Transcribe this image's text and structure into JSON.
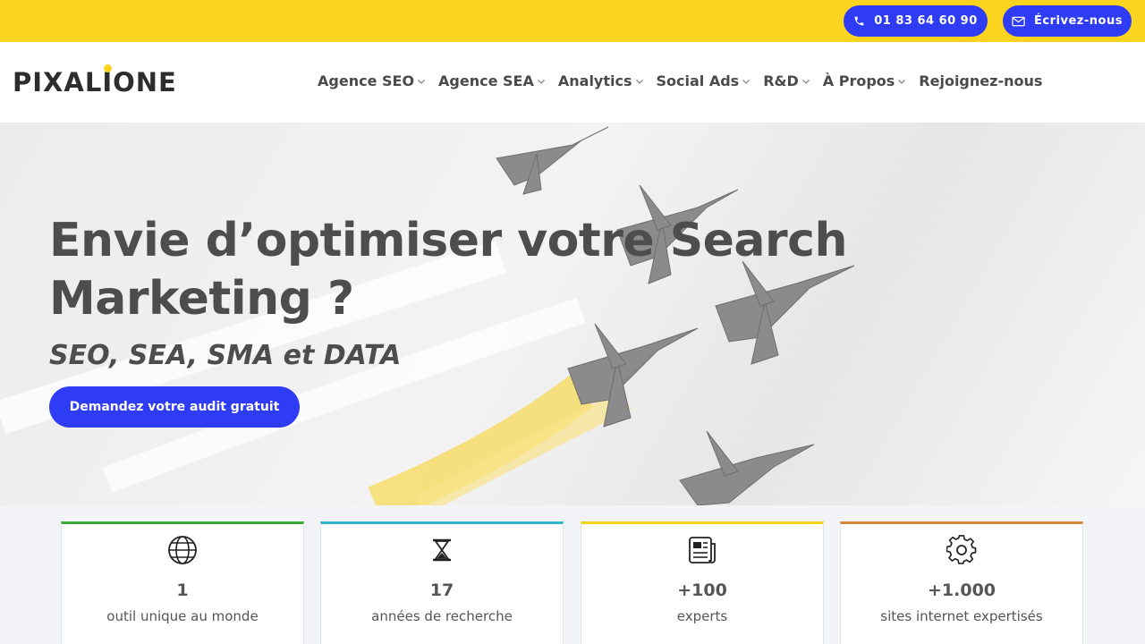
{
  "topbar": {
    "phone_label": "01 83 64 60 90",
    "mail_label": "Écrivez-nous",
    "background_color": "#fad41f",
    "button_color": "#2f3cf5"
  },
  "header": {
    "logo_before": "PIXAL",
    "logo_i": "I",
    "logo_after": "ONE",
    "nav": [
      {
        "label": "Agence SEO",
        "has_dropdown": true
      },
      {
        "label": "Agence SEA",
        "has_dropdown": true
      },
      {
        "label": "Analytics",
        "has_dropdown": true
      },
      {
        "label": "Social Ads",
        "has_dropdown": true
      },
      {
        "label": "R&D",
        "has_dropdown": true
      },
      {
        "label": "À Propos",
        "has_dropdown": true
      },
      {
        "label": "Rejoignez-nous",
        "has_dropdown": false
      }
    ]
  },
  "hero": {
    "title": "Envie d’optimiser votre Search Marketing ?",
    "subtitle": "SEO, SEA, SMA et DATA",
    "cta_label": "Demandez votre audit gratuit"
  },
  "stats": [
    {
      "icon": "globe-icon",
      "value": "1",
      "label": "outil unique au monde",
      "accent": "#3aa935"
    },
    {
      "icon": "hourglass-icon",
      "value": "17",
      "label": "années de recherche",
      "accent": "#33b5c9"
    },
    {
      "icon": "newspaper-icon",
      "value": "+100",
      "label": "experts",
      "accent": "#f2d31b"
    },
    {
      "icon": "gear-icon",
      "value": "+1.000",
      "label": "sites internet expertisés",
      "accent": "#d08a3a"
    }
  ]
}
